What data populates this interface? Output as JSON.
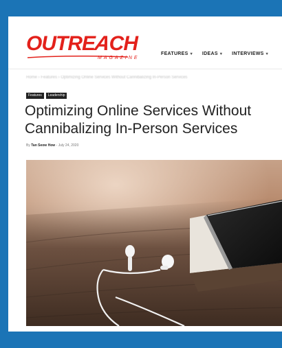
{
  "brand": {
    "name": "OUTREACH",
    "subtitle": "MAGAZINE",
    "color": "#e3211b"
  },
  "frame_color": "#1b74b6",
  "nav": [
    {
      "label": "FEATURES"
    },
    {
      "label": "IDEAS"
    },
    {
      "label": "INTERVIEWS"
    }
  ],
  "breadcrumb": "Home  ›  Features  ›  Optimizing Online Services Without Cannibalizing In-Person Services",
  "tags": [
    "Features",
    "Leadership"
  ],
  "article": {
    "title": "Optimizing Online Services Without Cannibalizing In-Person Services",
    "by_prefix": "By",
    "author": "Tan Seow How",
    "separator": "-",
    "date": "July 24, 2020"
  },
  "hero_image": {
    "description_icon": "phone-and-earphones-photo"
  }
}
